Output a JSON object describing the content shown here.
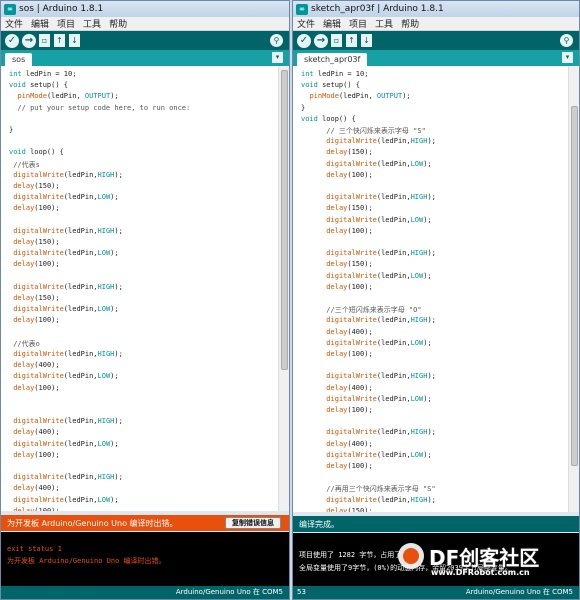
{
  "left": {
    "title": "sos | Arduino 1.8.1",
    "menu": [
      "文件",
      "编辑",
      "项目",
      "工具",
      "帮助"
    ],
    "tab": "sos",
    "status_msg": "为开发板 Arduino/Genuino Uno 编译时出错。",
    "copy_button": "复制错误信息",
    "console": [
      "exit status 1",
      "为开发板 Arduino/Genuino Uno 编译时出错。"
    ],
    "footer_board": "Arduino/Genuino Uno 在 COM5",
    "code": [
      "int ledPin = 10;",
      "void setup() {",
      "  pinMode(ledPin, OUTPUT);",
      "  // put your setup code here, to run once:",
      "",
      "}",
      "",
      "void loop() {",
      " //代表s",
      " digitalWrite(ledPin,HIGH);",
      " delay(150);",
      " digitalWrite(ledPin,LOW);",
      " delay(100);",
      "",
      " digitalWrite(ledPin,HIGH);",
      " delay(150);",
      " digitalWrite(ledPin,LOW);",
      " delay(100);",
      "",
      " digitalWrite(ledPin,HIGH);",
      " delay(150);",
      " digitalWrite(ledPin,LOW);",
      " delay(100);",
      "",
      " //代表o",
      " digitalWrite(ledPin,HIGH);",
      " delay(400);",
      " digitalWrite(ledPin,LOW);",
      " delay(100);",
      "",
      "",
      " digitalWrite(ledPin,HIGH);",
      " delay(400);",
      " digitalWrite(ledPin,LOW);",
      " delay(100);",
      "",
      " digitalWrite(ledPin,HIGH);",
      " delay(400);",
      " digitalWrite(ledPin,LOW);",
      " delay(100);"
    ]
  },
  "right": {
    "title": "sketch_apr03f | Arduino 1.8.1",
    "menu": [
      "文件",
      "编辑",
      "项目",
      "工具",
      "帮助"
    ],
    "tab": "sketch_apr03f",
    "status_msg": "编译完成。",
    "console": [
      "项目使用了 1282 字节，占用了",
      "全局变量使用了9字节，(0%)的动态内存，余留2039字节局部变量。"
    ],
    "footer_line": "53",
    "footer_board": "Arduino/Genuino Uno 在 COM5",
    "code": [
      "int ledPin = 10;",
      "void setup() {",
      "  pinMode(ledPin, OUTPUT);",
      "}",
      "void loop() {",
      "      // 三个快闪烁来表示字母 \"S\"",
      "      digitalWrite(ledPin,HIGH);",
      "      delay(150);",
      "      digitalWrite(ledPin,LOW);",
      "      delay(100);",
      "",
      "      digitalWrite(ledPin,HIGH);",
      "      delay(150);",
      "      digitalWrite(ledPin,LOW);",
      "      delay(100);",
      "",
      "      digitalWrite(ledPin,HIGH);",
      "      delay(150);",
      "      digitalWrite(ledPin,LOW);",
      "      delay(100);",
      "",
      "      //三个短闪烁来表示字母 \"O\"",
      "      digitalWrite(ledPin,HIGH);",
      "      delay(400);",
      "      digitalWrite(ledPin,LOW);",
      "      delay(100);",
      "",
      "      digitalWrite(ledPin,HIGH);",
      "      delay(400);",
      "      digitalWrite(ledPin,LOW);",
      "      delay(100);",
      "",
      "      digitalWrite(ledPin,HIGH);",
      "      delay(400);",
      "      digitalWrite(ledPin,LOW);",
      "      delay(100);",
      "",
      "      //再用三个快闪烁来表示字母 \"S\"",
      "      digitalWrite(ledPin,HIGH);",
      "      delay(150);"
    ]
  },
  "watermark": {
    "brand": "DF创客社区",
    "url": "www.DFRobot.com.cn"
  },
  "colors": {
    "teal_dark": "#006468",
    "teal_tab": "#17a1a5",
    "error_bar": "#e8500e",
    "ok_bar": "#006468",
    "console_bg": "#000000"
  },
  "icons": [
    "verify-icon",
    "upload-icon",
    "new-icon",
    "open-icon",
    "save-icon",
    "serial-monitor-icon",
    "tab-menu-icon"
  ]
}
